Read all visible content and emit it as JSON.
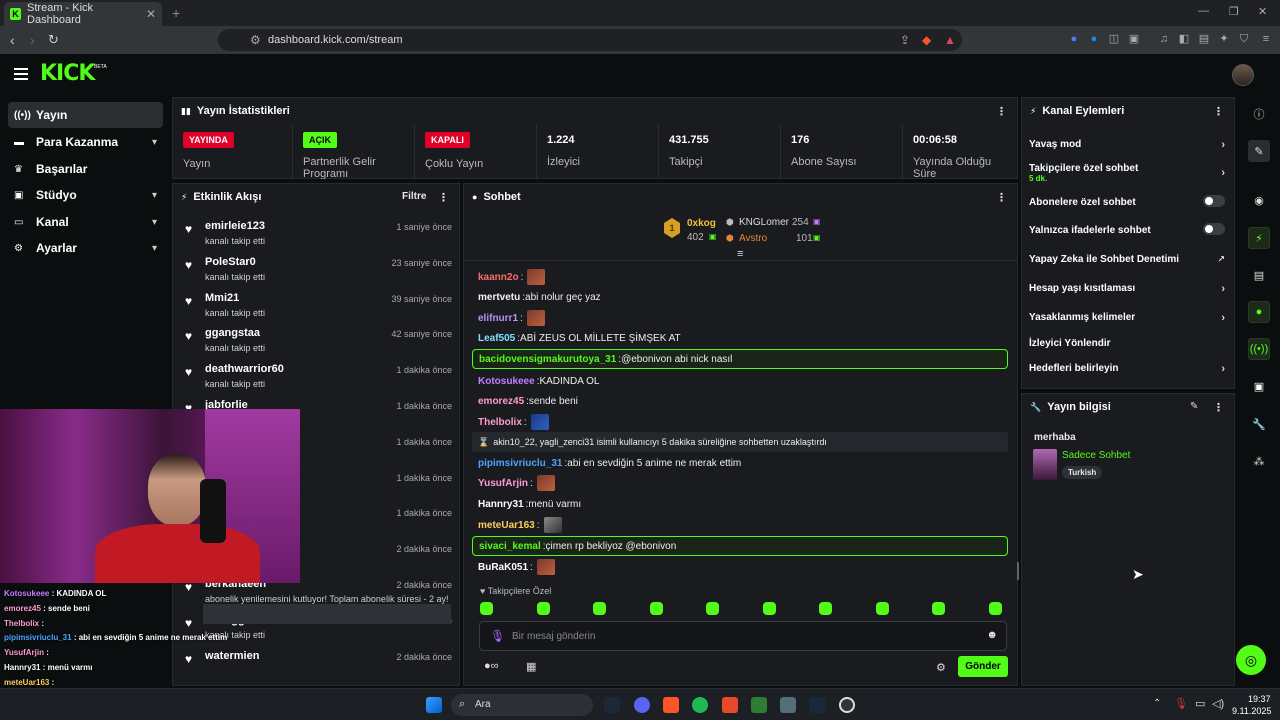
{
  "browser": {
    "tab_title": "Stream - Kick Dashboard",
    "url": "dashboard.kick.com/stream"
  },
  "header": {
    "logo": "KICK",
    "beta": "BETA"
  },
  "sidebar": {
    "items": [
      {
        "label": "Yayın"
      },
      {
        "label": "Para Kazanma"
      },
      {
        "label": "Başarılar"
      },
      {
        "label": "Stüdyo"
      },
      {
        "label": "Kanal"
      },
      {
        "label": "Ayarlar"
      }
    ]
  },
  "stats": {
    "title": "Yayın İstatistikleri",
    "cells": [
      {
        "badge": "YAYINDA",
        "label": "Yayın"
      },
      {
        "badge": "AÇIK",
        "label": "Partnerlik Gelir Programı"
      },
      {
        "badge": "KAPALI",
        "label": "Çoklu Yayın"
      },
      {
        "value": "1.224",
        "label": "İzleyici"
      },
      {
        "value": "431.755",
        "label": "Takipçi"
      },
      {
        "value": "176",
        "label": "Abone Sayısı"
      },
      {
        "value": "00:06:58",
        "label": "Yayında Olduğu Süre"
      }
    ]
  },
  "activity": {
    "title": "Etkinlik Akışı",
    "filter": "Filtre",
    "items": [
      {
        "user": "emirleie123",
        "text": "kanalı takip etti",
        "time": "1 saniye önce"
      },
      {
        "user": "PoleStar0",
        "text": "kanalı takip etti",
        "time": "23 saniye önce"
      },
      {
        "user": "Mmi21",
        "text": "kanalı takip etti",
        "time": "39 saniye önce"
      },
      {
        "user": "ggangstaa",
        "text": "kanalı takip etti",
        "time": "42 saniye önce"
      },
      {
        "user": "deathwarrior60",
        "text": "kanalı takip etti",
        "time": "1 dakika önce"
      },
      {
        "user": "jabforlie",
        "text": "",
        "time": "1 dakika önce"
      },
      {
        "user": "",
        "text": "",
        "time": "1 dakika önce"
      },
      {
        "user": "",
        "text": "",
        "time": "1 dakika önce"
      },
      {
        "user": "",
        "text": "",
        "time": "1 dakika önce"
      },
      {
        "user": "",
        "text": "",
        "time": "2 dakika önce"
      },
      {
        "user": "berkanaeen",
        "text": "abonelik yenilemesini kutluyor! Toplam abonelik süresi - 2 ay!",
        "time": "2 dakika önce"
      },
      {
        "user": "beddggaR",
        "text": "kanalı takip etti",
        "time": "2 dakika önce"
      },
      {
        "user": "watermien",
        "text": "",
        "time": "2 dakika önce"
      }
    ]
  },
  "chat": {
    "title": "Sohbet",
    "leaders": {
      "rank1": {
        "name": "0xkog",
        "count": "402"
      },
      "rank2": {
        "name": "KNGLomer",
        "count": "254"
      },
      "rank3": {
        "name": "Avstro",
        "count": "101"
      }
    },
    "messages": [
      {
        "user": "kaann2o",
        "text": "",
        "color": "#ff6b6b",
        "emote": true
      },
      {
        "user": "mertvetu",
        "text": "abi nolur geç yaz",
        "color": "#f2f2f2"
      },
      {
        "user": "elifnurr1",
        "text": "",
        "color": "#b794f6",
        "emote": true
      },
      {
        "user": "Leaf505",
        "text": "ABİ ZEUS OL MİLLETE ŞİMŞEK AT",
        "color": "#7ee0ff"
      },
      {
        "user": "bacidovensigmakurutoya_31",
        "text": "@ebonivon abi nick nasıl",
        "color": "#53fc18",
        "highlight": true
      },
      {
        "user": "Kotosukeee",
        "text": "KADINDA OL",
        "color": "#c77dff"
      },
      {
        "user": "emorez45",
        "text": "sende beni",
        "color": "#ff9bd0"
      },
      {
        "user": "Thelbolix",
        "text": "",
        "color": "#ff9bd0",
        "emote": true
      },
      {
        "system": "akin10_22, yagli_zenci31 isimli kullanıcıyı 5 dakika süreliğine sohbetten uzaklaştırdı"
      },
      {
        "user": "pipimsivriuclu_31",
        "text": "abi en sevdiğin 5 anime ne merak ettim",
        "color": "#4ea3ff"
      },
      {
        "user": "YusufArjin",
        "text": "",
        "color": "#ff9bd0",
        "emote": true
      },
      {
        "user": "Hannry31",
        "text": "menü varmı",
        "color": "#ffffff"
      },
      {
        "user": "meteUar163",
        "text": "",
        "color": "#ffcf5c",
        "emote": true
      },
      {
        "user": "sivaci_kemal",
        "text": "çimen rp bekliyoz @ebonivon",
        "color": "#53fc18",
        "highlight": true
      },
      {
        "user": "BuRaK051",
        "text": "",
        "color": "#ffffff",
        "emote": true
      }
    ],
    "followers_only": "Takipçilere Özel",
    "input_placeholder": "Bir mesaj gönderin",
    "send_label": "Gönder"
  },
  "channel_actions": {
    "title": "Kanal Eylemleri",
    "items": [
      {
        "label": "Yavaş mod",
        "kind": "arrow"
      },
      {
        "label": "Takipçilere özel sohbet",
        "sub": "5 dk.",
        "kind": "arrow"
      },
      {
        "label": "Abonelere özel sohbet",
        "kind": "toggle"
      },
      {
        "label": "Yalnızca ifadelerle sohbet",
        "kind": "toggle"
      },
      {
        "label": "Yapay Zeka ile Sohbet Denetimi",
        "kind": "ext"
      },
      {
        "label": "Hesap yaşı kısıtlaması",
        "kind": "arrow"
      },
      {
        "label": "Yasaklanmış kelimeler",
        "kind": "arrow"
      },
      {
        "label": "İzleyici Yönlendir",
        "kind": "none"
      },
      {
        "label": "Hedefleri belirleyin",
        "kind": "arrow"
      }
    ]
  },
  "stream_info": {
    "title": "Yayın bilgisi",
    "stream_title": "merhaba",
    "category": "Sadece Sohbet",
    "tag": "Turkish"
  },
  "overlay_chat": [
    {
      "user": "Kotosukeee",
      "text": "KADINDA OL",
      "color": "#c77dff"
    },
    {
      "user": "emorez45",
      "text": "sende beni",
      "color": "#ff9bd0"
    },
    {
      "user": "Thelbolix",
      "text": "",
      "color": "#ff9bd0"
    },
    {
      "user": "pipimsivriuclu_31",
      "text": "abi en sevdiğin 5 anime ne merak ettim",
      "color": "#4ea3ff"
    },
    {
      "user": "YusufArjin",
      "text": "",
      "color": "#ff9bd0"
    },
    {
      "user": "Hannry31",
      "text": "menü varmı",
      "color": "#ffffff"
    },
    {
      "user": "meteUar163",
      "text": "",
      "color": "#ffcf5c"
    },
    {
      "user": "sivaci_kemal",
      "text": "çimen rp bekliyoz @ebonivon",
      "color": "#53fc18"
    }
  ],
  "taskbar": {
    "search": "Ara",
    "time": "19:37",
    "date": "9.11.2025"
  },
  "colors": {
    "accent": "#53fc18",
    "live": "#e0002a",
    "panel": "#191b1f"
  }
}
